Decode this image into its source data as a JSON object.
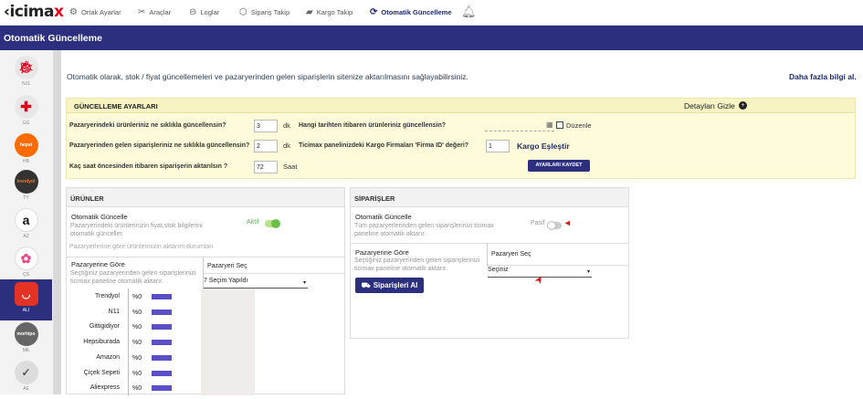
{
  "app": {
    "logo": "ticimax"
  },
  "nav": [
    {
      "label": "Ortak Ayarlar",
      "icon": "gear-icon"
    },
    {
      "label": "Araçlar",
      "icon": "tools-icon"
    },
    {
      "label": "Loglar",
      "icon": "logs-icon"
    },
    {
      "label": "Sipariş Takip",
      "icon": "box-icon"
    },
    {
      "label": "Kargo Takip",
      "icon": "truck-icon"
    },
    {
      "label": "Otomatik Güncelleme",
      "icon": "sync-icon",
      "active": true
    }
  ],
  "page_title": "Otomatik Güncelleme",
  "sidebar": [
    {
      "abbr": "N11",
      "label": "N11",
      "color": "#e8e8e8"
    },
    {
      "abbr": "GG",
      "label": "GG",
      "color": "#e8e8e8"
    },
    {
      "abbr": "hb",
      "label": "HB",
      "color": "#ff6b00"
    },
    {
      "abbr": "ty",
      "label": "TY",
      "color": "#f27a1a"
    },
    {
      "abbr": "a",
      "label": "AZ",
      "color": "#ffffff"
    },
    {
      "abbr": "ÇS",
      "label": "ÇS",
      "color": "#ffffff"
    },
    {
      "abbr": "ALI",
      "label": "ALI",
      "color": "#e43225"
    },
    {
      "abbr": "MK",
      "label": "MK",
      "color": "#666666"
    },
    {
      "abbr": "AE",
      "label": "AE",
      "color": "#dddddd"
    }
  ],
  "intro": "Otomatik olarak, stok / fiyat güncellemeleri ve pazaryerinden gelen siparişlerin sitenize aktarılmasını sağlayabilirsiniz.",
  "more_info": "Daha fazla bilgi al.",
  "settings": {
    "title": "GÜNCELLEME AYARLARI",
    "toggle_details": "Detayları Gizle",
    "q1": "Pazaryerindeki ürünleriniz ne sıklıkla güncellensin?",
    "q1_value": "3",
    "q1_unit": "dk",
    "q2": "Pazaryerinden gelen siparişleriniz ne sıklıkla güncellensin?",
    "q2_value": "2",
    "q2_unit": "dk",
    "q3": "Kaç saat öncesinden itibaren siparişerin aktarılsın ?",
    "q3_value": "72",
    "q3_unit": "Saat",
    "q4": "Hangi tarihten itibaren ürünleriniz güncellensin?",
    "q4_checkbox": "Düzenle",
    "q5": "Ticimax panelinizdeki Kargo Firmaları 'Firma ID' değeri?",
    "q5_value": "1",
    "kargo_link": "Kargo Eşleştir",
    "save_button": "AYARLARI KAYDET"
  },
  "urunler": {
    "title": "ÜRÜNLER",
    "auto_title": "Otomatik Güncelle",
    "auto_desc": "Pazaryerindeki ürünlerinizin fiyat,stok bilgilerini otomatik günceller.",
    "state": "Aktif",
    "hint": "Pazaryerlerine göre ürünlerinizin aktarım durumları",
    "by_mp_title": "Pazaryerine Göre",
    "by_mp_desc": "Seçtiğiniz pazaryerinden gelen siparişlerinizi ticimax paneline otomatik aktarır.",
    "mp_col": "Pazaryeri Seç",
    "mp_select": "7 Seçim Yapıldı",
    "rows": [
      {
        "name": "Trendyol",
        "pct": "%0"
      },
      {
        "name": "N11",
        "pct": "%0"
      },
      {
        "name": "Gittigidiyor",
        "pct": "%0"
      },
      {
        "name": "Hepsiburada",
        "pct": "%0"
      },
      {
        "name": "Amazon",
        "pct": "%0"
      },
      {
        "name": "Çiçek Sepeti",
        "pct": "%0"
      },
      {
        "name": "Aliexpress",
        "pct": "%0"
      }
    ]
  },
  "siparisler": {
    "title": "SİPARİŞLER",
    "auto_title": "Otomatik Güncelle",
    "auto_desc": "Tüm pazaryerlerinden gelen siparişlerinizi ticimax paneline otomatik aktarır.",
    "state": "Pasif",
    "by_mp_title": "Pazaryerine Göre",
    "by_mp_desc": "Seçtiğiniz pazaryerinden gelen siparişlerinizi ticimax paneline otomatik aktarır.",
    "mp_col": "Pazaryeri Seç",
    "mp_select": "Seçiniz",
    "import_button": "Siparişleri Al"
  }
}
